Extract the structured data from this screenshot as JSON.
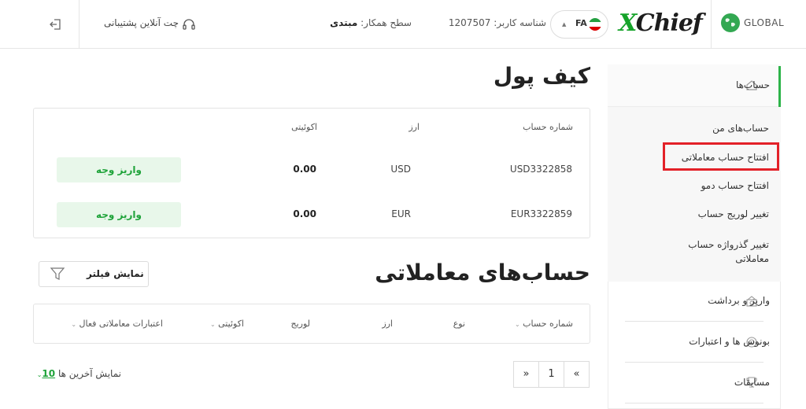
{
  "header": {
    "global_label": "GLOBAL",
    "brand": {
      "x": "X",
      "rest": "Chief"
    },
    "lang_code": "FA",
    "user_id_label": "شناسه کاربر:",
    "user_id_value": "1207507",
    "partner_level_label": "سطح همکار:",
    "partner_level_value": "مبتدی",
    "support_label": "چت آنلاین پشتیبانی"
  },
  "sidebar": {
    "accounts_label": "حساب‌ها",
    "sub_items": [
      {
        "label": "حساب‌های من"
      },
      {
        "label": "افتتاح حساب معاملاتی"
      },
      {
        "label": "افتتاح حساب دمو"
      },
      {
        "label": "تغییر لوریج حساب"
      },
      {
        "label": "تغییر گذرواژه حساب معاملاتی"
      }
    ],
    "items": [
      {
        "label": "واریز و برداشت"
      },
      {
        "label": "بونوس ها و اعتبارات"
      },
      {
        "label": "مسابقات"
      }
    ]
  },
  "wallet": {
    "title": "کیف پول",
    "headers": {
      "account_number": "شماره حساب",
      "currency": "ارز",
      "equity": "اکوئیتی"
    },
    "rows": [
      {
        "account": "USD3322858",
        "currency": "USD",
        "equity": "0.00",
        "button": "واریز وجه"
      },
      {
        "account": "EUR3322859",
        "currency": "EUR",
        "equity": "0.00",
        "button": "واریز وجه"
      }
    ]
  },
  "trading": {
    "title": "حساب‌های معاملاتی",
    "filter_button": "نمایش فیلتر",
    "columns": {
      "account_number": "شماره حساب",
      "type": "نوع",
      "currency": "ارز",
      "leverage": "لوریج",
      "equity": "اکوئیتی",
      "active_credit": "اعتبارات معاملاتی فعال"
    }
  },
  "pagination": {
    "first": "«",
    "page": "1",
    "last": "»",
    "show_last_label": "نمایش آخرین ها",
    "show_last_value": "10"
  },
  "colors": {
    "accent": "#1fa33a",
    "highlight": "#e32128"
  }
}
